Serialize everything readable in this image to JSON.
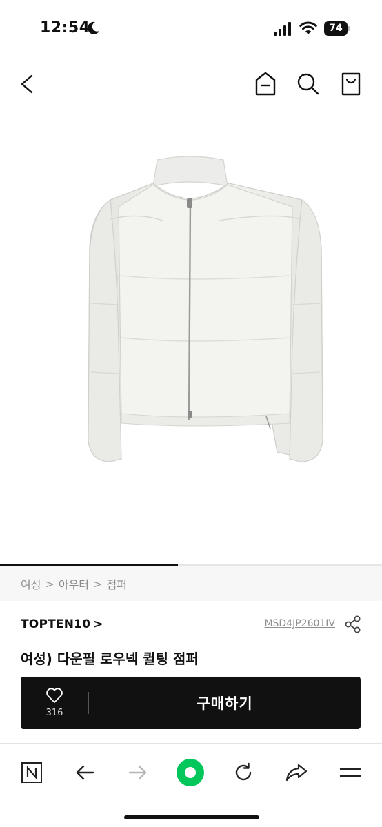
{
  "status_bar": {
    "time": "12:54",
    "battery": "74"
  },
  "header": {
    "back": "back-icon",
    "home": "home-icon",
    "search": "search-icon",
    "bag": "shopping-bag-icon"
  },
  "image_gallery": {
    "progress": 0.465
  },
  "breadcrumb": {
    "items": [
      "여성",
      "아우터",
      "점퍼"
    ],
    "separator": ">"
  },
  "product": {
    "brand": "TOPTEN10",
    "brand_chevron": ">",
    "code": "MSD4JP2601IV",
    "title": "여성) 다운필 로우넥 퀼팅 점퍼"
  },
  "buy_bar": {
    "wish_count": "316",
    "buy_label": "구매하기"
  },
  "toolbar": {
    "icons": [
      "naver-n-icon",
      "arrow-left-icon",
      "arrow-right-icon",
      "green-home-dot-icon",
      "reload-icon",
      "share-arrow-icon",
      "menu-icon"
    ],
    "accent": "#03c75a"
  }
}
